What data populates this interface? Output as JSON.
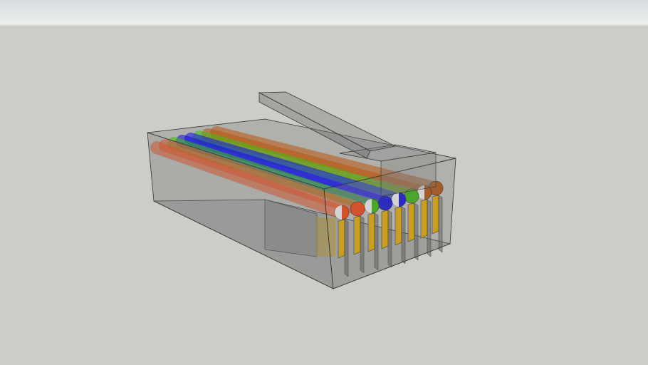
{
  "viewer": {
    "sky_color": "#e2e6e7",
    "ground_color": "#cdcdc8"
  },
  "model": {
    "body_color": "#6e6e6e",
    "pin_color": "#f3b500",
    "wires": [
      {
        "name": "white-orange",
        "color": "#ff4a10",
        "striped": true
      },
      {
        "name": "orange",
        "color": "#ff4a10",
        "striped": false
      },
      {
        "name": "white-green",
        "color": "#3fbf10",
        "striped": true
      },
      {
        "name": "blue",
        "color": "#1010e0",
        "striped": false
      },
      {
        "name": "white-blue",
        "color": "#1010e0",
        "striped": true
      },
      {
        "name": "green",
        "color": "#3fbf10",
        "striped": false
      },
      {
        "name": "white-brown",
        "color": "#b8560e",
        "striped": true
      },
      {
        "name": "brown",
        "color": "#b8560e",
        "striped": false
      }
    ]
  }
}
